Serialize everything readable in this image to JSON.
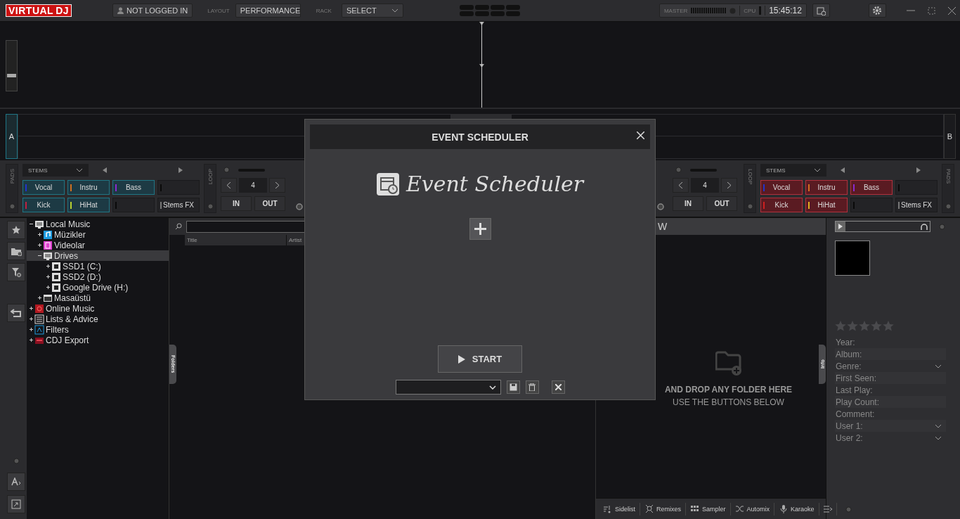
{
  "top_bar": {
    "logo_left": "VIRTUAL",
    "logo_right": "DJ",
    "login": "NOT LOGGED IN",
    "layout_label": "LAYOUT",
    "layout_value": "PERFORMANCE",
    "rack_label": "RACK",
    "rack_value": "SELECT",
    "master_label": "MASTER",
    "cpu_label": "CPU",
    "clock": "15:45:12"
  },
  "waveform": {
    "slider": {
      "level": 0.3
    }
  },
  "decks": [
    {
      "label": "A",
      "selected": true,
      "color": "#1f7585",
      "pads_label": "PADS",
      "pad_mode": "STEMS",
      "loop_label": "LOOP",
      "loop_size": "4",
      "loop_in": "IN",
      "loop_out": "OUT",
      "pads": [
        {
          "kind": "stem",
          "label": "Vocal",
          "color": "#2233cc"
        },
        {
          "kind": "stem",
          "label": "Instru",
          "color": "#d07020"
        },
        {
          "kind": "stem",
          "label": "Bass",
          "color": "#8a2ad0"
        },
        {
          "kind": "empty",
          "color": "#0a0a0a"
        },
        {
          "kind": "stem",
          "label": "Kick",
          "color": "#c02040"
        },
        {
          "kind": "stem",
          "label": "HiHat",
          "color": "#b8d030"
        },
        {
          "kind": "empty",
          "color": "#0a0a0a"
        },
        {
          "kind": "fx",
          "label": "Stems FX",
          "color": "#777777"
        }
      ]
    },
    {
      "label": "B",
      "selected": false,
      "color": "#b0303c",
      "pads_label": "PADS",
      "pad_mode": "STEMS",
      "loop_label": "LOOP",
      "loop_size": "4",
      "loop_in": "IN",
      "loop_out": "OUT",
      "pads": [
        {
          "kind": "stem",
          "label": "Vocal",
          "color": "#2233cc"
        },
        {
          "kind": "stem",
          "label": "Instru",
          "color": "#d07020"
        },
        {
          "kind": "stem",
          "label": "Bass",
          "color": "#8a2ad0"
        },
        {
          "kind": "empty",
          "color": "#0a0a0a"
        },
        {
          "kind": "stem",
          "label": "Kick",
          "color": "#d02020"
        },
        {
          "kind": "stem",
          "label": "HiHat",
          "color": "#e0b020"
        },
        {
          "kind": "empty",
          "color": "#0a0a0a"
        },
        {
          "kind": "fx",
          "label": "Stems FX",
          "color": "#777777"
        }
      ]
    }
  ],
  "tree": [
    {
      "label": "Local Music",
      "kind": "monitor",
      "expanded": true,
      "selected": false,
      "children": [
        {
          "label": "Müzikler",
          "kind": "music",
          "expanded": false,
          "selected": false
        },
        {
          "label": "Videolar",
          "kind": "video",
          "expanded": false,
          "selected": false
        },
        {
          "label": "Drives",
          "kind": "monitor",
          "expanded": true,
          "selected": true,
          "children": [
            {
              "label": "SSD1 (C:)",
              "kind": "drive",
              "expanded": false,
              "selected": false
            },
            {
              "label": "SSD2 (D:)",
              "kind": "drive",
              "expanded": false,
              "selected": false
            },
            {
              "label": "Google Drive (H:)",
              "kind": "drive",
              "expanded": false,
              "selected": false
            }
          ]
        },
        {
          "label": "Masaüstü",
          "kind": "folder",
          "expanded": false,
          "selected": false
        }
      ]
    },
    {
      "label": "Online Music",
      "kind": "online",
      "expanded": false,
      "selected": false
    },
    {
      "label": "Lists & Advice",
      "kind": "list",
      "expanded": false,
      "selected": false
    },
    {
      "label": "Filters",
      "kind": "filter",
      "expanded": false,
      "selected": false
    },
    {
      "label": "CDJ Export",
      "kind": "cdj",
      "expanded": false,
      "selected": false
    }
  ],
  "file_list": {
    "columns": [
      "Title",
      "Artist"
    ]
  },
  "side_tabs": {
    "folders": "Folders",
    "info": "Info"
  },
  "sideview": {
    "title": "W",
    "drop_text": "AND DROP ANY FOLDER HERE",
    "hint": "USE THE BUTTONS BELOW",
    "tabs": [
      "Sidelist",
      "Remixes",
      "Sampler",
      "Automix",
      "Karaoke"
    ]
  },
  "info": {
    "stars": 0,
    "fields": [
      {
        "label": "Year:",
        "dropdown": false
      },
      {
        "label": "Album:",
        "dropdown": false
      },
      {
        "label": "Genre:",
        "dropdown": true
      },
      {
        "label": "First Seen:",
        "dropdown": false
      },
      {
        "label": "Last Play:",
        "dropdown": false
      },
      {
        "label": "Play Count:",
        "dropdown": false
      },
      {
        "label": "Comment:",
        "dropdown": false
      },
      {
        "label": "User 1:",
        "dropdown": true
      },
      {
        "label": "User 2:",
        "dropdown": true
      }
    ]
  },
  "dialog": {
    "title": "EVENT SCHEDULER",
    "heading": "Event Scheduler",
    "start": "START"
  }
}
